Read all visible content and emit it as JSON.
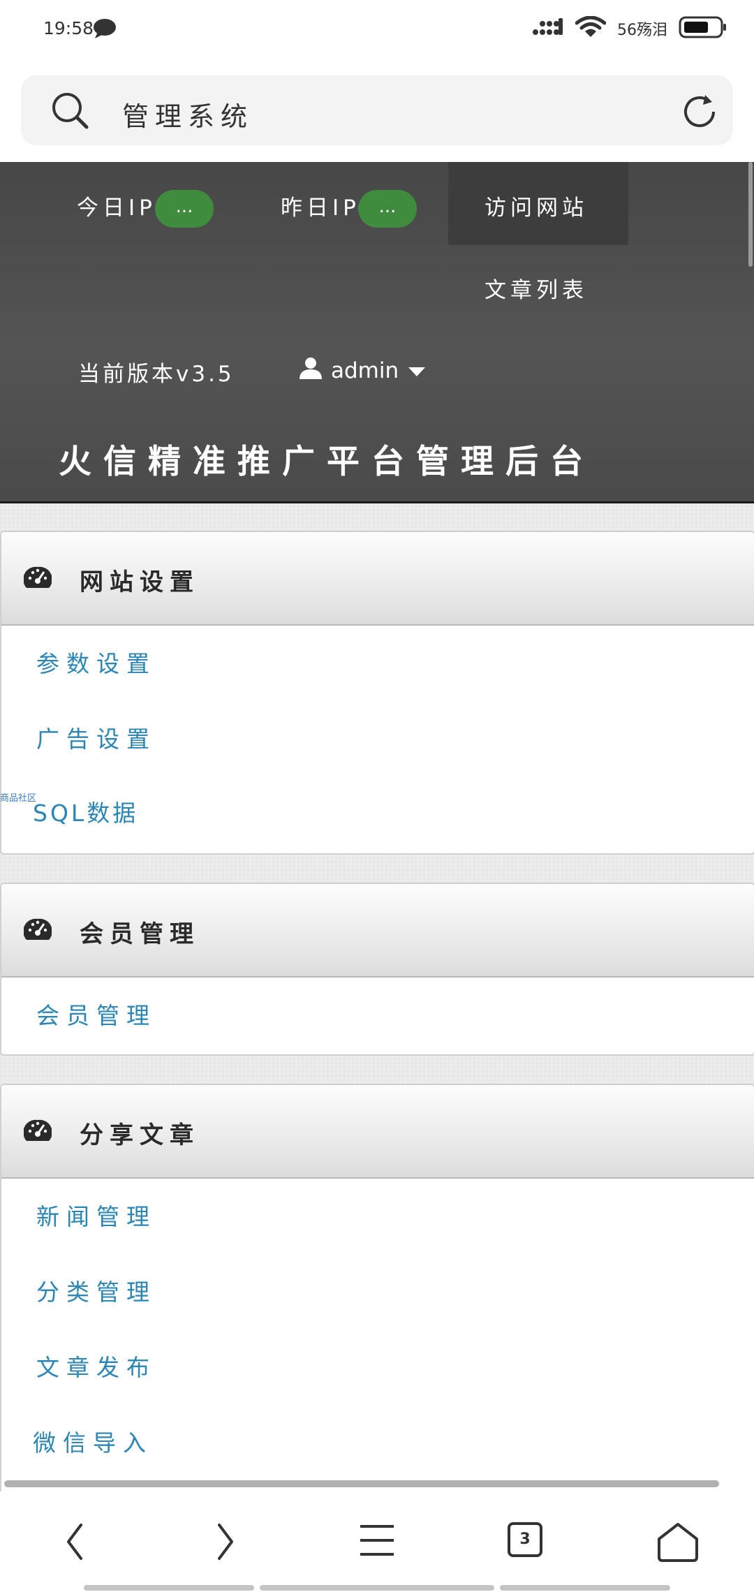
{
  "status_bar": {
    "time": "19:58",
    "network": "56殇泪",
    "icons": [
      "chat-bubble-icon",
      "signal-icon",
      "wifi-icon",
      "battery-icon"
    ]
  },
  "browser": {
    "url_text": "管理系统",
    "icons": [
      "search-icon",
      "refresh-icon"
    ]
  },
  "header": {
    "today_ip_label": "今日IP",
    "today_ip_value": "...",
    "yesterday_ip_label": "昨日IP",
    "yesterday_ip_value": "...",
    "visit_site": "访问网站",
    "article_list": "文章列表",
    "version": "当前版本v3.5",
    "user": "admin",
    "site_title": "火信精准推广平台管理后台",
    "colors": {
      "pill": "#3f8c3f",
      "header_bg": "#4c4c4c",
      "link": "#2a86b6"
    }
  },
  "panels": [
    {
      "title": "网站设置",
      "icon": "dashboard-icon",
      "items": [
        "参数设置",
        "广告设置",
        "SQL数据"
      ]
    },
    {
      "title": "会员管理",
      "icon": "dashboard-icon",
      "items": [
        "会员管理"
      ]
    },
    {
      "title": "分享文章",
      "icon": "dashboard-icon",
      "items": [
        "新闻管理",
        "分类管理",
        "文章发布",
        "微信导入"
      ]
    }
  ],
  "watermark": "商品社区",
  "bottom_nav": {
    "tab_count": "3",
    "icons": [
      "back-icon",
      "forward-icon",
      "menu-icon",
      "tabs-icon",
      "home-icon"
    ]
  }
}
